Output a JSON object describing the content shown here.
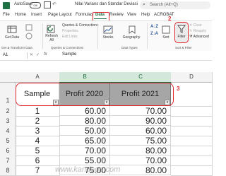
{
  "titlebar": {
    "autosave_label": "AutoSave",
    "toggle_state": "Off",
    "doc_title": "Nilai Varians dan Standar Deviasi",
    "search_placeholder": "Search (Alt+Q)"
  },
  "tabs": [
    "File",
    "Home",
    "Insert",
    "Page Layout",
    "Formulas",
    "Data",
    "Review",
    "View",
    "Help",
    "ACROBAT"
  ],
  "active_tab": "Data",
  "ribbon": {
    "get_data": "Get Data",
    "refresh_all": "Refresh All",
    "queries_connections": "Queries & Connections",
    "properties": "Properties",
    "edit_links": "Edit Links",
    "stocks": "Stocks",
    "geography": "Geography",
    "sort": "Sort",
    "filter": "Filter",
    "clear": "Clear",
    "reapply": "Reapply",
    "advanced": "Advanced",
    "group_get_transform": "Get & Transform Data",
    "group_queries": "Queries & Connections",
    "group_data_types": "Data Types",
    "group_sort_filter": "Sort & Filter"
  },
  "annotations": {
    "step2": "2",
    "step3": "3"
  },
  "formula_bar": {
    "name_box": "A1",
    "fx": "fx",
    "value": "Sample"
  },
  "columns": [
    "A",
    "B",
    "C",
    "D"
  ],
  "headers": [
    "Sample",
    "Profit 2020",
    "Profit 2021"
  ],
  "rows": [
    {
      "row": "1",
      "a": "",
      "b": "",
      "c": ""
    },
    {
      "row": "2",
      "a": "1",
      "b": "60.00",
      "c": "70.00"
    },
    {
      "row": "3",
      "a": "2",
      "b": "80.00",
      "c": "90.00"
    },
    {
      "row": "4",
      "a": "3",
      "b": "50.00",
      "c": "60.00"
    },
    {
      "row": "5",
      "a": "4",
      "b": "65.00",
      "c": "75.00"
    },
    {
      "row": "6",
      "a": "5",
      "b": "70.00",
      "c": "80.00"
    },
    {
      "row": "7",
      "a": "6",
      "b": "55.00",
      "c": "70.00"
    },
    {
      "row": "8",
      "a": "7",
      "b": "75.00",
      "c": "80.00"
    }
  ],
  "watermark": "www.kandaga.com",
  "colors": {
    "accent": "#1e7145",
    "highlight": "#e0262c"
  }
}
